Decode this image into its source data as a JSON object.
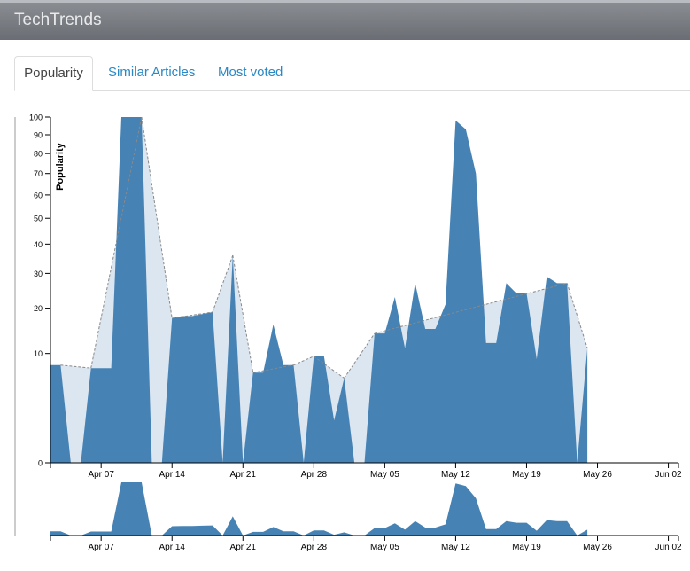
{
  "app": {
    "title": "TechTrends"
  },
  "tabs": [
    {
      "label": "Popularity",
      "active": true
    },
    {
      "label": "Similar Articles",
      "active": false
    },
    {
      "label": "Most voted",
      "active": false
    }
  ],
  "colors": {
    "area": "#4682b4",
    "interpolated": "#dce6f0",
    "dashed": "#888888"
  },
  "chart_data": {
    "type": "area",
    "ylabel": "Popularity",
    "y_scale": "sqrt",
    "ylim": [
      0,
      100
    ],
    "y_ticks": [
      0,
      10,
      20,
      30,
      40,
      50,
      60,
      70,
      80,
      90,
      100
    ],
    "x_ticks": [
      "Apr 07",
      "Apr 14",
      "Apr 21",
      "Apr 28",
      "May 05",
      "May 12",
      "May 19",
      "May 26",
      "Jun 02"
    ],
    "xlim": [
      "2013-04-02",
      "2013-06-03"
    ],
    "grid": false,
    "series": [
      {
        "points": [
          [
            "2013-04-02",
            8
          ],
          [
            "2013-04-03",
            8
          ],
          [
            "2013-04-04",
            0
          ],
          [
            "2013-04-05",
            0
          ],
          [
            "2013-04-06",
            7.5
          ],
          [
            "2013-04-07",
            7.5
          ],
          [
            "2013-04-08",
            7.5
          ],
          [
            "2013-04-09",
            100
          ],
          [
            "2013-04-10",
            100
          ],
          [
            "2013-04-11",
            100
          ],
          [
            "2013-04-12",
            0
          ],
          [
            "2013-04-13",
            0
          ],
          [
            "2013-04-14",
            17.5
          ],
          [
            "2013-04-15",
            18
          ],
          [
            "2013-04-16",
            18
          ],
          [
            "2013-04-17",
            18.5
          ],
          [
            "2013-04-18",
            19
          ],
          [
            "2013-04-19",
            0
          ],
          [
            "2013-04-20",
            36
          ],
          [
            "2013-04-21",
            0
          ],
          [
            "2013-04-22",
            6.8
          ],
          [
            "2013-04-23",
            6.8
          ],
          [
            "2013-04-24",
            16
          ],
          [
            "2013-04-25",
            8
          ],
          [
            "2013-04-26",
            8
          ],
          [
            "2013-04-27",
            0
          ],
          [
            "2013-04-28",
            9.5
          ],
          [
            "2013-04-29",
            9.5
          ],
          [
            "2013-04-30",
            1.5
          ],
          [
            "2013-05-01",
            6
          ],
          [
            "2013-05-02",
            0
          ],
          [
            "2013-05-03",
            0
          ],
          [
            "2013-05-04",
            14
          ],
          [
            "2013-05-05",
            14
          ],
          [
            "2013-05-06",
            23
          ],
          [
            "2013-05-07",
            11
          ],
          [
            "2013-05-08",
            27
          ],
          [
            "2013-05-09",
            15
          ],
          [
            "2013-05-10",
            15
          ],
          [
            "2013-05-11",
            21
          ],
          [
            "2013-05-12",
            98
          ],
          [
            "2013-05-13",
            93
          ],
          [
            "2013-05-14",
            70
          ],
          [
            "2013-05-15",
            12
          ],
          [
            "2013-05-16",
            12
          ],
          [
            "2013-05-17",
            27
          ],
          [
            "2013-05-18",
            24
          ],
          [
            "2013-05-19",
            24
          ],
          [
            "2013-05-20",
            9
          ],
          [
            "2013-05-21",
            29
          ],
          [
            "2013-05-22",
            27
          ],
          [
            "2013-05-23",
            27
          ],
          [
            "2013-05-24",
            0
          ],
          [
            "2013-05-25",
            11
          ]
        ]
      }
    ],
    "interpolated": [
      [
        "2013-04-03",
        8
      ],
      [
        "2013-04-06",
        7.5
      ],
      [
        "2013-04-11",
        100
      ],
      [
        "2013-04-14",
        17.5
      ],
      [
        "2013-04-18",
        19
      ],
      [
        "2013-04-20",
        36
      ],
      [
        "2013-04-22",
        6.8
      ],
      [
        "2013-04-26",
        8
      ],
      [
        "2013-04-28",
        9.5
      ],
      [
        "2013-05-01",
        6
      ],
      [
        "2013-05-04",
        14
      ],
      [
        "2013-05-23",
        27
      ],
      [
        "2013-05-25",
        11
      ]
    ]
  }
}
